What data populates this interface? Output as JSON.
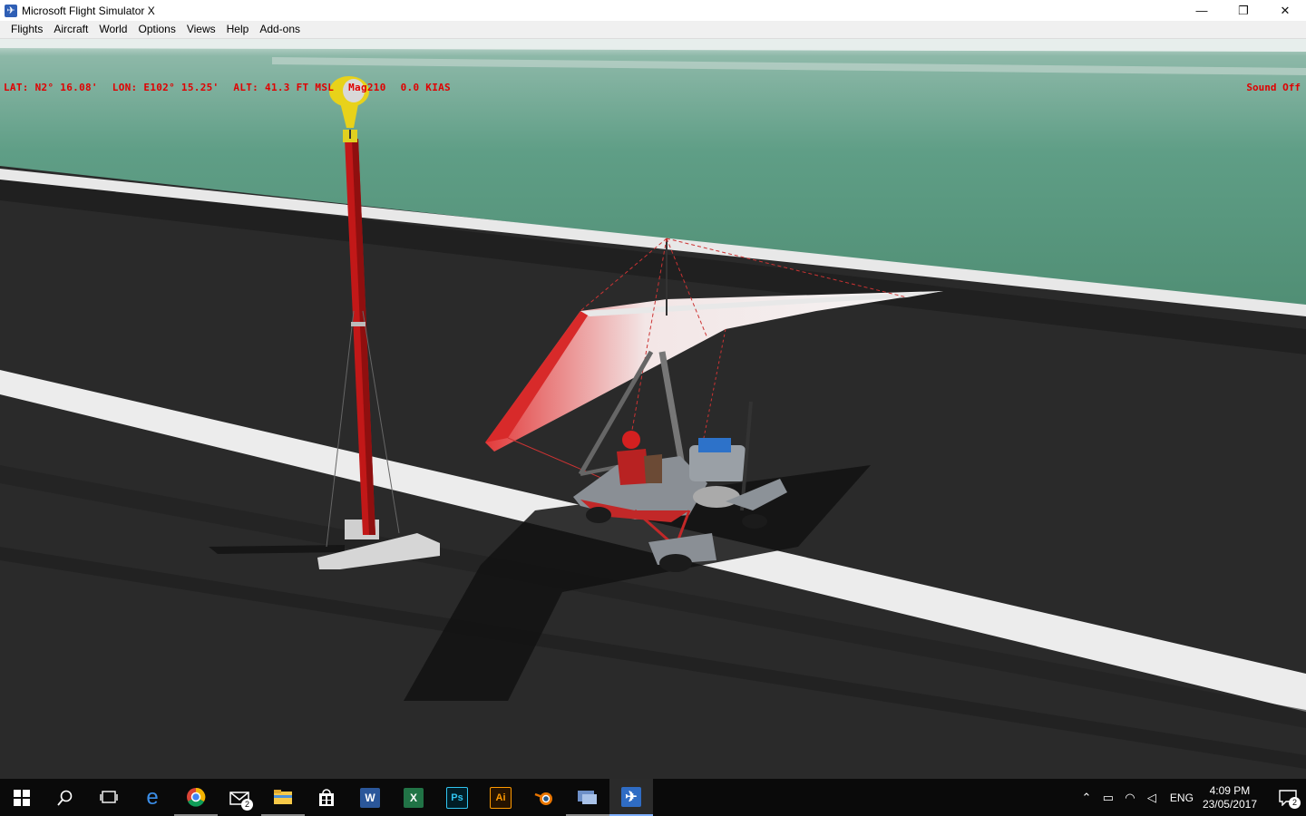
{
  "window": {
    "title": "Microsoft Flight Simulator X",
    "minimize": "—",
    "restore": "❐",
    "close": "✕"
  },
  "menu": [
    "Flights",
    "Aircraft",
    "World",
    "Options",
    "Views",
    "Help",
    "Add-ons"
  ],
  "hud": {
    "lat": "LAT: N2° 16.08'",
    "lon": "LON: E102° 15.25'",
    "alt": "ALT: 41.3 FT  MSL",
    "heading": "Mag210",
    "speed": "0.0 KIAS",
    "sound": "Sound Off"
  },
  "colors": {
    "hud_text": "#e00000",
    "runway": "#2a2a2a",
    "water": "#5f9e86",
    "taskbar": "#0a0a0a"
  },
  "taskbar": {
    "apps": [
      {
        "icon": "search-icon"
      },
      {
        "icon": "task-view-icon"
      },
      {
        "icon": "edge-icon",
        "label": "e"
      },
      {
        "icon": "chrome-icon"
      },
      {
        "icon": "mail-icon",
        "badge": "2"
      },
      {
        "icon": "file-explorer-icon"
      },
      {
        "icon": "store-icon"
      },
      {
        "icon": "word-icon",
        "label": "W"
      },
      {
        "icon": "excel-icon",
        "label": "X"
      },
      {
        "icon": "photoshop-icon",
        "label": "Ps"
      },
      {
        "icon": "illustrator-icon",
        "label": "Ai"
      },
      {
        "icon": "blender-icon"
      },
      {
        "icon": "remote-desktop-icon"
      },
      {
        "icon": "flight-simulator-icon"
      }
    ],
    "tray": {
      "language": "ENG",
      "time": "4:09 PM",
      "date": "23/05/2017",
      "notification_count": "2"
    }
  }
}
